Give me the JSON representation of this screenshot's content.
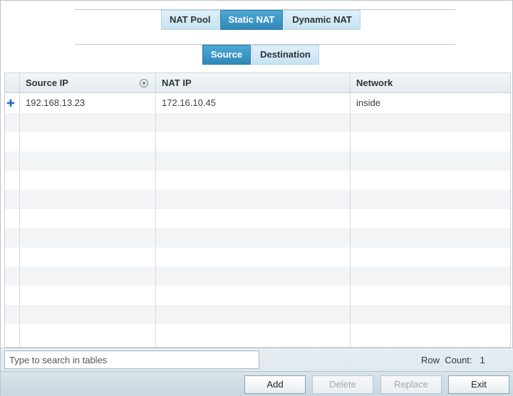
{
  "top_tabs": [
    {
      "label": "NAT Pool",
      "active": false
    },
    {
      "label": "Static NAT",
      "active": true
    },
    {
      "label": "Dynamic NAT",
      "active": false
    }
  ],
  "sub_tabs": [
    {
      "label": "Source",
      "active": true
    },
    {
      "label": "Destination",
      "active": false
    }
  ],
  "table": {
    "columns": [
      "Source IP",
      "NAT IP",
      "Network"
    ],
    "rows": [
      [
        "192.168.13.23",
        "172.16.10.45",
        "inside"
      ]
    ]
  },
  "footer": {
    "search_placeholder": "Type to search in tables",
    "row_count_label": "Row  Count:",
    "row_count_value": "1"
  },
  "buttons": {
    "add": "Add",
    "delete": "Delete",
    "replace": "Replace",
    "exit": "Exit"
  },
  "colors": {
    "active_tab": "#2f88b8",
    "inactive_tab": "#c6e3f2",
    "expand_icon": "#2f6fcf"
  }
}
